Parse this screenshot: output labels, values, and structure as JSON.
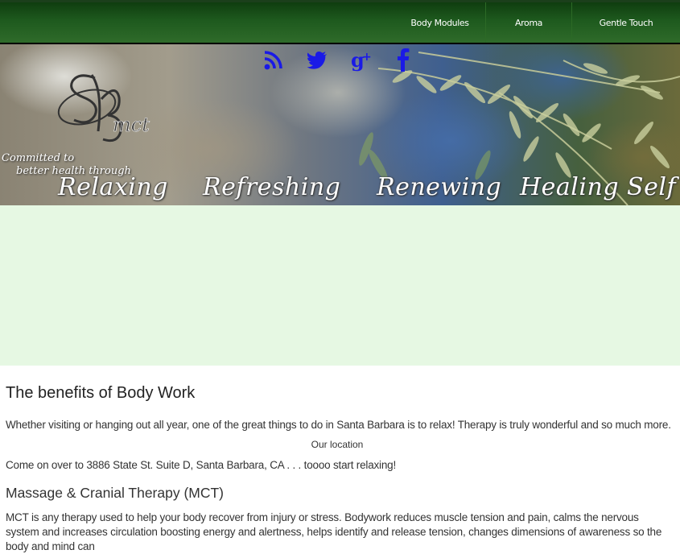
{
  "nav": {
    "items": [
      {
        "label": "Body Modules"
      },
      {
        "label": "Aroma"
      },
      {
        "label": "Gentle Touch"
      }
    ]
  },
  "social": {
    "icons": [
      "rss-icon",
      "twitter-icon",
      "google-plus-icon",
      "facebook-icon"
    ],
    "color": "#1a1ae6"
  },
  "banner": {
    "tagline_line1": "Committed to",
    "tagline_line2": "better health through",
    "words": [
      "Relaxing",
      "Refreshing",
      "Renewing",
      "Healing Self C"
    ]
  },
  "colors": {
    "topbar": "#1e5a1e",
    "mint_panel": "#e6f8e3"
  },
  "content": {
    "heading": "The benefits of Body Work",
    "intro": "Whether visiting or hanging out all year, one of the great things to do in Santa Barbara is to relax! Therapy is truly wonderful and so much more.",
    "location_label": "Our location",
    "address_text": "Come on over to 3886 State St. Suite D, Santa Barbara, CA . . . toooo start relaxing!",
    "subheading": "Massage & Cranial Therapy (MCT)",
    "mct_text": "MCT is any therapy used to help your body recover from injury or stress. Bodywork reduces muscle tension and pain, calms the nervous system and increases circulation boosting energy and alertness, helps identify and release tension, changes dimensions of awareness so the body and mind can"
  }
}
